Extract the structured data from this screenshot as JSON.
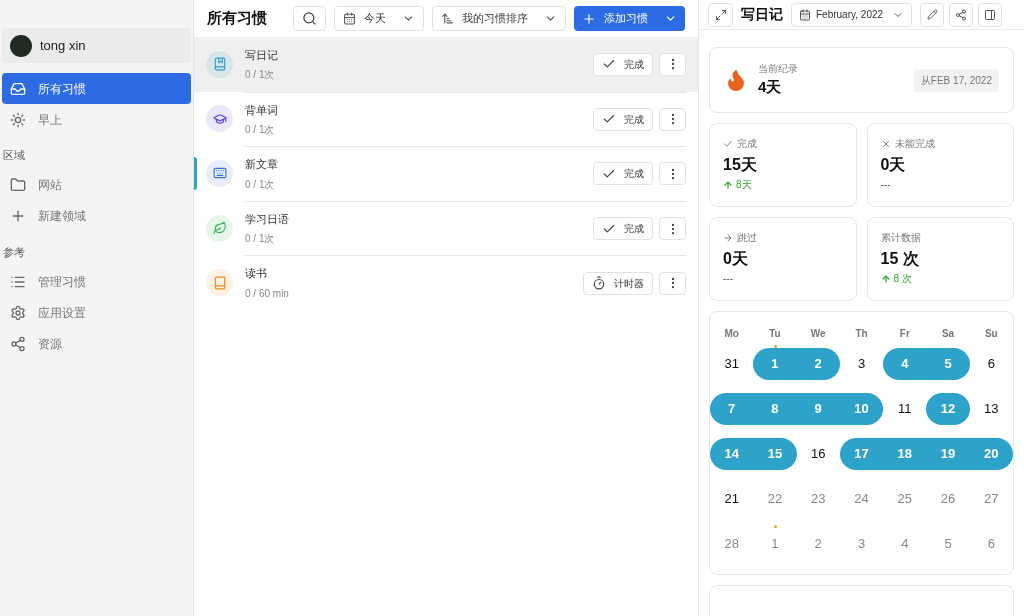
{
  "sidebar": {
    "user": {
      "name": "tong xin"
    },
    "groups": [
      {
        "items": [
          {
            "label": "所有习惯",
            "selected": true
          },
          {
            "label": "早上",
            "selected": false
          }
        ]
      },
      {
        "heading": "区域",
        "items": [
          {
            "label": "网站",
            "selected": false
          },
          {
            "label": "新建领域",
            "selected": false
          }
        ]
      },
      {
        "heading": "参考",
        "items": [
          {
            "label": "管理习惯",
            "selected": false
          },
          {
            "label": "应用设置",
            "selected": false
          },
          {
            "label": "资源",
            "selected": false
          }
        ]
      }
    ]
  },
  "list": {
    "title": "所有习惯",
    "filters": [
      {
        "label": "今天"
      },
      {
        "label": "我的习惯排序"
      }
    ],
    "add_button": "添加习惯",
    "habits": [
      {
        "name": "写日记",
        "progress": "0 / 1次",
        "color": "#2ea3c9",
        "selected": true,
        "focused": false,
        "action": {
          "kind": "check",
          "label": "完成"
        }
      },
      {
        "name": "背单词",
        "progress": "0 / 1次",
        "color": "#4f46e5",
        "selected": false,
        "focused": false,
        "action": {
          "kind": "check",
          "label": "完成"
        }
      },
      {
        "name": "新文章",
        "progress": "0 / 1次",
        "color": "#3b6fe0",
        "selected": false,
        "focused": true,
        "action": {
          "kind": "check",
          "label": "完成"
        }
      },
      {
        "name": "学习日语",
        "progress": "0 / 1次",
        "color": "#3bb55a",
        "selected": false,
        "focused": false,
        "action": {
          "kind": "check",
          "label": "完成"
        }
      },
      {
        "name": "读书",
        "progress": "0 / 60 min",
        "color": "#f08c1a",
        "selected": false,
        "focused": false,
        "action": {
          "kind": "timer",
          "label": "计时器"
        }
      }
    ]
  },
  "detail": {
    "title": "写日记",
    "month": "February, 2022",
    "streak": {
      "label": "当前纪录",
      "value": "4天",
      "since": "从FEB 17, 2022"
    },
    "stats": [
      {
        "kind": "done",
        "label": "完成",
        "value": "15天",
        "delta": "8天",
        "up": true
      },
      {
        "kind": "missed",
        "label": "未能完成",
        "value": "0天",
        "delta": "---",
        "up": false
      },
      {
        "kind": "skipped",
        "label": "跳过",
        "value": "0天",
        "delta": "---",
        "up": false
      },
      {
        "kind": "total",
        "label": "累计数据",
        "value": "15 次",
        "delta": "8 次",
        "up": true
      }
    ],
    "weekdays": [
      "Mo",
      "Tu",
      "We",
      "Th",
      "Fr",
      "Sa",
      "Su"
    ],
    "weeks": [
      [
        {
          "day": "31",
          "done": false,
          "muted": false,
          "dot": false
        },
        {
          "day": "1",
          "done": true,
          "muted": false,
          "dot": true
        },
        {
          "day": "2",
          "done": true,
          "muted": false,
          "dot": false
        },
        {
          "day": "3",
          "done": false,
          "muted": false,
          "dot": false
        },
        {
          "day": "4",
          "done": true,
          "muted": false,
          "dot": false
        },
        {
          "day": "5",
          "done": true,
          "muted": false,
          "dot": false
        },
        {
          "day": "6",
          "done": false,
          "muted": false,
          "dot": false
        }
      ],
      [
        {
          "day": "7",
          "done": true,
          "muted": false,
          "dot": false
        },
        {
          "day": "8",
          "done": true,
          "muted": false,
          "dot": false
        },
        {
          "day": "9",
          "done": true,
          "muted": false,
          "dot": false
        },
        {
          "day": "10",
          "done": true,
          "muted": false,
          "dot": false
        },
        {
          "day": "11",
          "done": false,
          "muted": false,
          "dot": false
        },
        {
          "day": "12",
          "done": true,
          "muted": false,
          "dot": false
        },
        {
          "day": "13",
          "done": false,
          "muted": false,
          "dot": false
        }
      ],
      [
        {
          "day": "14",
          "done": true,
          "muted": false,
          "dot": false
        },
        {
          "day": "15",
          "done": true,
          "muted": false,
          "dot": false
        },
        {
          "day": "16",
          "done": false,
          "muted": false,
          "dot": false
        },
        {
          "day": "17",
          "done": true,
          "muted": false,
          "dot": false
        },
        {
          "day": "18",
          "done": true,
          "muted": false,
          "dot": false
        },
        {
          "day": "19",
          "done": true,
          "muted": false,
          "dot": false
        },
        {
          "day": "20",
          "done": true,
          "muted": false,
          "dot": false
        }
      ],
      [
        {
          "day": "21",
          "done": false,
          "muted": false,
          "dot": false
        },
        {
          "day": "22",
          "done": false,
          "muted": true,
          "dot": false
        },
        {
          "day": "23",
          "done": false,
          "muted": true,
          "dot": false
        },
        {
          "day": "24",
          "done": false,
          "muted": true,
          "dot": false
        },
        {
          "day": "25",
          "done": false,
          "muted": true,
          "dot": false
        },
        {
          "day": "26",
          "done": false,
          "muted": true,
          "dot": false
        },
        {
          "day": "27",
          "done": false,
          "muted": true,
          "dot": false
        }
      ],
      [
        {
          "day": "28",
          "done": false,
          "muted": true,
          "dot": false
        },
        {
          "day": "1",
          "done": false,
          "muted": true,
          "dot": true
        },
        {
          "day": "2",
          "done": false,
          "muted": true,
          "dot": false
        },
        {
          "day": "3",
          "done": false,
          "muted": true,
          "dot": false
        },
        {
          "day": "4",
          "done": false,
          "muted": true,
          "dot": false
        },
        {
          "day": "5",
          "done": false,
          "muted": true,
          "dot": false
        },
        {
          "day": "6",
          "done": false,
          "muted": true,
          "dot": false
        }
      ]
    ]
  }
}
